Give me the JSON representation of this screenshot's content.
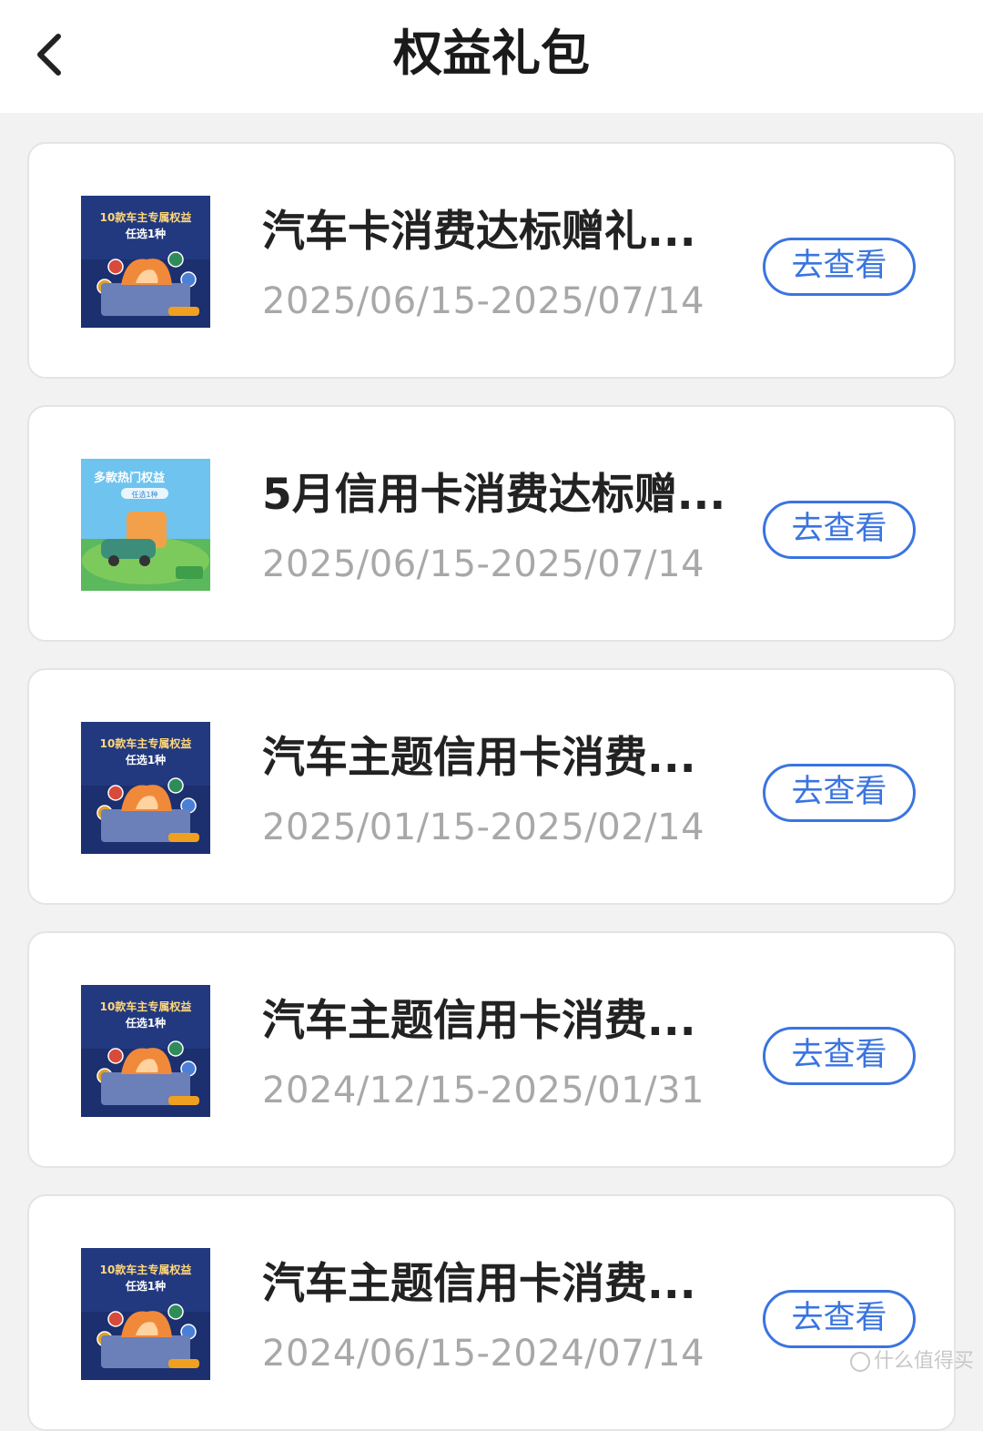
{
  "header": {
    "back_icon": "chevron-left-icon",
    "title": "权益礼包"
  },
  "items": [
    {
      "title": "汽车卡消费达标赠礼...",
      "date": "2025/06/15-2025/07/14",
      "button": "去查看",
      "thumb_style": "car",
      "thumb_text1": "10款车主专属权益",
      "thumb_text2": "任选1种"
    },
    {
      "title": "5月信用卡消费达标赠...",
      "date": "2025/06/15-2025/07/14",
      "button": "去查看",
      "thumb_style": "popular",
      "thumb_text1": "多款热门权益",
      "thumb_text2": "任选1种"
    },
    {
      "title": "汽车主题信用卡消费...",
      "date": "2025/01/15-2025/02/14",
      "button": "去查看",
      "thumb_style": "car",
      "thumb_text1": "10款车主专属权益",
      "thumb_text2": "任选1种"
    },
    {
      "title": "汽车主题信用卡消费...",
      "date": "2024/12/15-2025/01/31",
      "button": "去查看",
      "thumb_style": "car",
      "thumb_text1": "10款车主专属权益",
      "thumb_text2": "任选1种"
    },
    {
      "title": "汽车主题信用卡消费...",
      "date": "2024/06/15-2024/07/14",
      "button": "去查看",
      "thumb_style": "car",
      "thumb_text1": "10款车主专属权益",
      "thumb_text2": "任选1种"
    }
  ],
  "watermark": "什么值得买",
  "colors": {
    "accent": "#3a74e0",
    "background": "#f2f2f2",
    "date_text": "#a8a8a8"
  }
}
